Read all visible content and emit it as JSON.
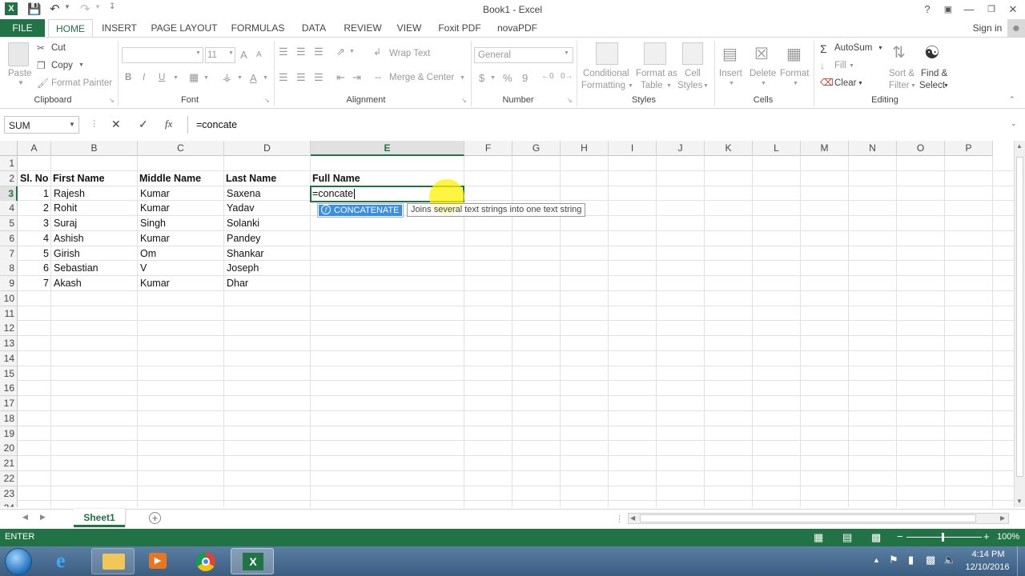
{
  "title_bar": {
    "title": "Book1 - Excel",
    "help": "?",
    "sign_in": "Sign in"
  },
  "ribbon_tabs": [
    {
      "label": "FILE"
    },
    {
      "label": "HOME"
    },
    {
      "label": "INSERT"
    },
    {
      "label": "PAGE LAYOUT"
    },
    {
      "label": "FORMULAS"
    },
    {
      "label": "DATA"
    },
    {
      "label": "REVIEW"
    },
    {
      "label": "VIEW"
    },
    {
      "label": "Foxit PDF"
    },
    {
      "label": "novaPDF"
    }
  ],
  "ribbon": {
    "clipboard": {
      "paste": "Paste",
      "cut": "Cut",
      "copy": "Copy",
      "format_painter": "Format Painter",
      "group": "Clipboard"
    },
    "font": {
      "font_size": "11",
      "bold": "B",
      "italic": "I",
      "underline": "U",
      "grow": "A",
      "shrink": "A",
      "color": "A",
      "group": "Font"
    },
    "alignment": {
      "wrap_text": "Wrap Text",
      "merge_center": "Merge & Center",
      "group": "Alignment"
    },
    "number": {
      "format": "General",
      "currency": "$",
      "percent": "%",
      "comma": "9",
      "group": "Number"
    },
    "styles": {
      "conditional": "Conditional",
      "conditional2": "Formatting",
      "format_as": "Format as",
      "format_as2": "Table",
      "cell": "Cell",
      "cell2": "Styles",
      "group": "Styles"
    },
    "cells": {
      "insert": "Insert",
      "delete": "Delete",
      "format": "Format",
      "group": "Cells"
    },
    "editing": {
      "autosum": "AutoSum",
      "fill": "Fill",
      "clear": "Clear",
      "sort": "Sort &",
      "sort2": "Filter",
      "find": "Find &",
      "find2": "Select",
      "group": "Editing"
    }
  },
  "formula_bar": {
    "name_box": "SUM",
    "cancel": "✕",
    "enter": "✓",
    "fx": "fx",
    "formula": "=concate"
  },
  "columns": [
    "A",
    "B",
    "C",
    "D",
    "E",
    "F",
    "G",
    "H",
    "I",
    "J",
    "K",
    "L",
    "M",
    "N",
    "O",
    "P"
  ],
  "rows": [
    "1",
    "2",
    "3",
    "4",
    "5",
    "6",
    "7",
    "8",
    "9",
    "10",
    "11",
    "12",
    "13",
    "14",
    "15",
    "16",
    "17",
    "18",
    "19",
    "20",
    "21",
    "22",
    "23",
    "24"
  ],
  "headers": {
    "sl_no": "Sl. No",
    "first": "First Name",
    "middle": "Middle Name",
    "last": "Last Name",
    "full": "Full Name"
  },
  "data_rows": [
    {
      "sl": "1",
      "first": "Rajesh",
      "middle": "Kumar",
      "last": "Saxena"
    },
    {
      "sl": "2",
      "first": "Rohit",
      "middle": "Kumar",
      "last": "Yadav"
    },
    {
      "sl": "3",
      "first": "Suraj",
      "middle": "Singh",
      "last": "Solanki"
    },
    {
      "sl": "4",
      "first": "Ashish",
      "middle": "Kumar",
      "last": "Pandey"
    },
    {
      "sl": "5",
      "first": "Girish",
      "middle": "Om",
      "last": "Shankar"
    },
    {
      "sl": "6",
      "first": "Sebastian",
      "middle": "V",
      "last": "Joseph"
    },
    {
      "sl": "7",
      "first": "Akash",
      "middle": "Kumar",
      "last": "Dhar"
    }
  ],
  "active_cell": {
    "text": "=concate"
  },
  "autocomplete": {
    "item": "CONCATENATE",
    "tooltip": "Joins several text strings into one text string"
  },
  "sheet_tabs": {
    "active": "Sheet1",
    "add": "+"
  },
  "status_bar": {
    "mode": "ENTER",
    "zoom": "100%"
  },
  "taskbar": {
    "time": "4:14 PM",
    "date": "12/10/2016"
  },
  "colors": {
    "excel_green": "#217346",
    "grid_line": "#e1e1e1",
    "highlight": "#ffff00",
    "autocomplete_blue": "#3a8ee6"
  }
}
